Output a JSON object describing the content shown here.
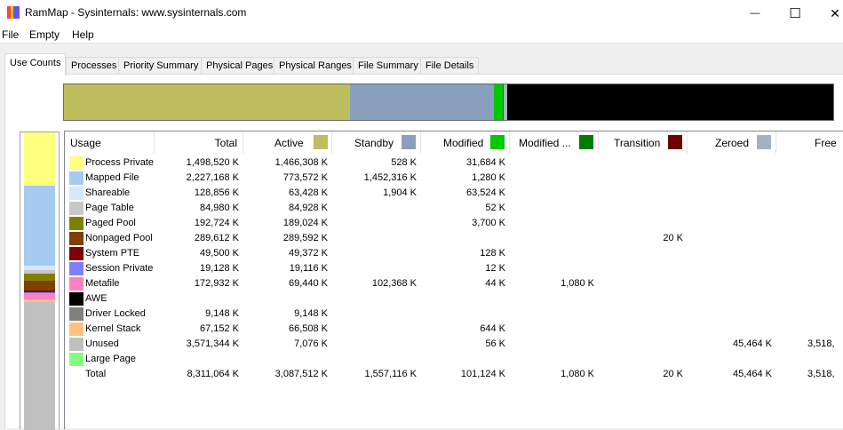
{
  "window": {
    "title": "RamMap - Sysinternals: www.sysinternals.com",
    "minimize_glyph": "—",
    "maximize_glyph": "☐",
    "close_glyph": "✕"
  },
  "menu": {
    "file": "File",
    "empty": "Empty",
    "help": "Help"
  },
  "tabs": [
    "Use Counts",
    "Processes",
    "Priority Summary",
    "Physical Pages",
    "Physical Ranges",
    "File Summary",
    "File Details"
  ],
  "columns": {
    "usage": "Usage",
    "total": "Total",
    "active": "Active",
    "standby": "Standby",
    "modified": "Modified",
    "modified_nowrite": "Modified ...",
    "transition": "Transition",
    "zeroed": "Zeroed",
    "free": "Free"
  },
  "column_colors": {
    "active": "#bebe5e",
    "standby": "#889fbd",
    "modified": "#00c800",
    "modified_nowrite": "#007c00",
    "transition": "#6e0000",
    "zeroed": "#a4b1c1"
  },
  "rows": [
    {
      "usage": "Process Private",
      "color": "#ffff80",
      "total": "1,498,520 K",
      "active": "1,466,308 K",
      "standby": "528 K",
      "modified": "31,684 K",
      "modified_nowrite": "",
      "transition": "",
      "zeroed": "",
      "free": ""
    },
    {
      "usage": "Mapped File",
      "color": "#a6caf0",
      "total": "2,227,168 K",
      "active": "773,572 K",
      "standby": "1,452,316 K",
      "modified": "1,280 K",
      "modified_nowrite": "",
      "transition": "",
      "zeroed": "",
      "free": ""
    },
    {
      "usage": "Shareable",
      "color": "#d4e8fc",
      "total": "128,856 K",
      "active": "63,428 K",
      "standby": "1,904 K",
      "modified": "63,524 K",
      "modified_nowrite": "",
      "transition": "",
      "zeroed": "",
      "free": ""
    },
    {
      "usage": "Page Table",
      "color": "#c8c8c8",
      "total": "84,980 K",
      "active": "84,928 K",
      "standby": "",
      "modified": "52 K",
      "modified_nowrite": "",
      "transition": "",
      "zeroed": "",
      "free": ""
    },
    {
      "usage": "Paged Pool",
      "color": "#808000",
      "total": "192,724 K",
      "active": "189,024 K",
      "standby": "",
      "modified": "3,700 K",
      "modified_nowrite": "",
      "transition": "",
      "zeroed": "",
      "free": ""
    },
    {
      "usage": "Nonpaged Pool",
      "color": "#804000",
      "total": "289,612 K",
      "active": "289,592 K",
      "standby": "",
      "modified": "",
      "modified_nowrite": "",
      "transition": "20 K",
      "zeroed": "",
      "free": ""
    },
    {
      "usage": "System PTE",
      "color": "#800000",
      "total": "49,500 K",
      "active": "49,372 K",
      "standby": "",
      "modified": "128 K",
      "modified_nowrite": "",
      "transition": "",
      "zeroed": "",
      "free": ""
    },
    {
      "usage": "Session Private",
      "color": "#8080ff",
      "total": "19,128 K",
      "active": "19,116 K",
      "standby": "",
      "modified": "12 K",
      "modified_nowrite": "",
      "transition": "",
      "zeroed": "",
      "free": ""
    },
    {
      "usage": "Metafile",
      "color": "#ff80c0",
      "total": "172,932 K",
      "active": "69,440 K",
      "standby": "102,368 K",
      "modified": "44 K",
      "modified_nowrite": "1,080 K",
      "transition": "",
      "zeroed": "",
      "free": ""
    },
    {
      "usage": "AWE",
      "color": "#000000",
      "total": "",
      "active": "",
      "standby": "",
      "modified": "",
      "modified_nowrite": "",
      "transition": "",
      "zeroed": "",
      "free": ""
    },
    {
      "usage": "Driver Locked",
      "color": "#808080",
      "total": "9,148 K",
      "active": "9,148 K",
      "standby": "",
      "modified": "",
      "modified_nowrite": "",
      "transition": "",
      "zeroed": "",
      "free": ""
    },
    {
      "usage": "Kernel Stack",
      "color": "#ffc080",
      "total": "67,152 K",
      "active": "66,508 K",
      "standby": "",
      "modified": "644 K",
      "modified_nowrite": "",
      "transition": "",
      "zeroed": "",
      "free": ""
    },
    {
      "usage": "Unused",
      "color": "#c0c0c0",
      "total": "3,571,344 K",
      "active": "7,076 K",
      "standby": "",
      "modified": "56 K",
      "modified_nowrite": "",
      "transition": "",
      "zeroed": "45,464 K",
      "free": "3,518,"
    },
    {
      "usage": "Large Page",
      "color": "#80ff80",
      "total": "",
      "active": "",
      "standby": "",
      "modified": "",
      "modified_nowrite": "",
      "transition": "",
      "zeroed": "",
      "free": ""
    },
    {
      "usage": "Total",
      "color": "",
      "total": "8,311,064 K",
      "active": "3,087,512 K",
      "standby": "1,557,116 K",
      "modified": "101,124 K",
      "modified_nowrite": "1,080 K",
      "transition": "20 K",
      "zeroed": "45,464 K",
      "free": "3,518,"
    }
  ],
  "memory_bar": [
    {
      "name": "active",
      "color": "#bebe5e",
      "value": 3087512
    },
    {
      "name": "standby",
      "color": "#889fbd",
      "value": 1557116
    },
    {
      "name": "modified",
      "color": "#00c800",
      "value": 101124
    },
    {
      "name": "modified-no-write",
      "color": "#007c00",
      "value": 1080
    },
    {
      "name": "transition",
      "color": "#6e0000",
      "value": 20
    },
    {
      "name": "zeroed",
      "color": "#a4b1c1",
      "value": 45464
    },
    {
      "name": "free",
      "color": "#000000",
      "value": 3518744
    }
  ]
}
